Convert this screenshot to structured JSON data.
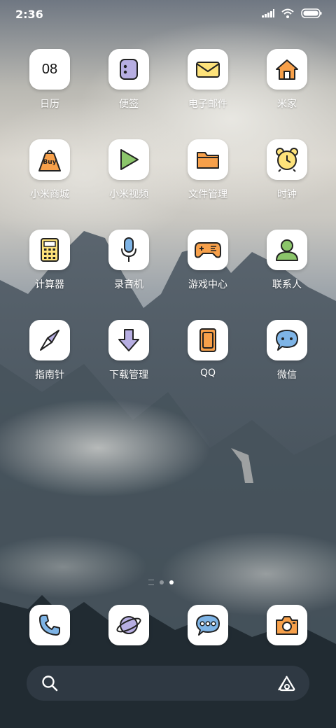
{
  "status_bar": {
    "time": "2:36"
  },
  "apps": [
    {
      "name": "日历",
      "icon": "calendar-icon",
      "icon_text": "08"
    },
    {
      "name": "便签",
      "icon": "notes-icon"
    },
    {
      "name": "电子邮件",
      "icon": "mail-icon"
    },
    {
      "name": "米家",
      "icon": "home-icon"
    },
    {
      "name": "小米商城",
      "icon": "shopping-bag-icon",
      "icon_text": "Buy"
    },
    {
      "name": "小米视频",
      "icon": "play-icon"
    },
    {
      "name": "文件管理",
      "icon": "folder-icon"
    },
    {
      "name": "时钟",
      "icon": "alarm-clock-icon"
    },
    {
      "name": "计算器",
      "icon": "calculator-icon"
    },
    {
      "name": "录音机",
      "icon": "microphone-icon"
    },
    {
      "name": "游戏中心",
      "icon": "gamepad-icon"
    },
    {
      "name": "联系人",
      "icon": "contact-person-icon"
    },
    {
      "name": "指南针",
      "icon": "compass-icon"
    },
    {
      "name": "下载管理",
      "icon": "download-arrow-icon"
    },
    {
      "name": "QQ",
      "icon": "qq-icon"
    },
    {
      "name": "微信",
      "icon": "wechat-bubble-icon"
    }
  ],
  "dock": [
    {
      "icon": "phone-icon"
    },
    {
      "icon": "browser-planet-icon"
    },
    {
      "icon": "messages-icon"
    },
    {
      "icon": "camera-icon"
    }
  ],
  "search_bar": {
    "left_icon": "search-icon",
    "right_icon": "assistant-icon"
  },
  "page_indicator": {
    "pages": 2,
    "current": 2
  },
  "colors": {
    "yellow": "#fde27a",
    "orange": "#f7a04a",
    "green": "#8bc56a",
    "purple": "#b7aee2",
    "blue": "#7eb4e6",
    "outline": "#222222"
  }
}
